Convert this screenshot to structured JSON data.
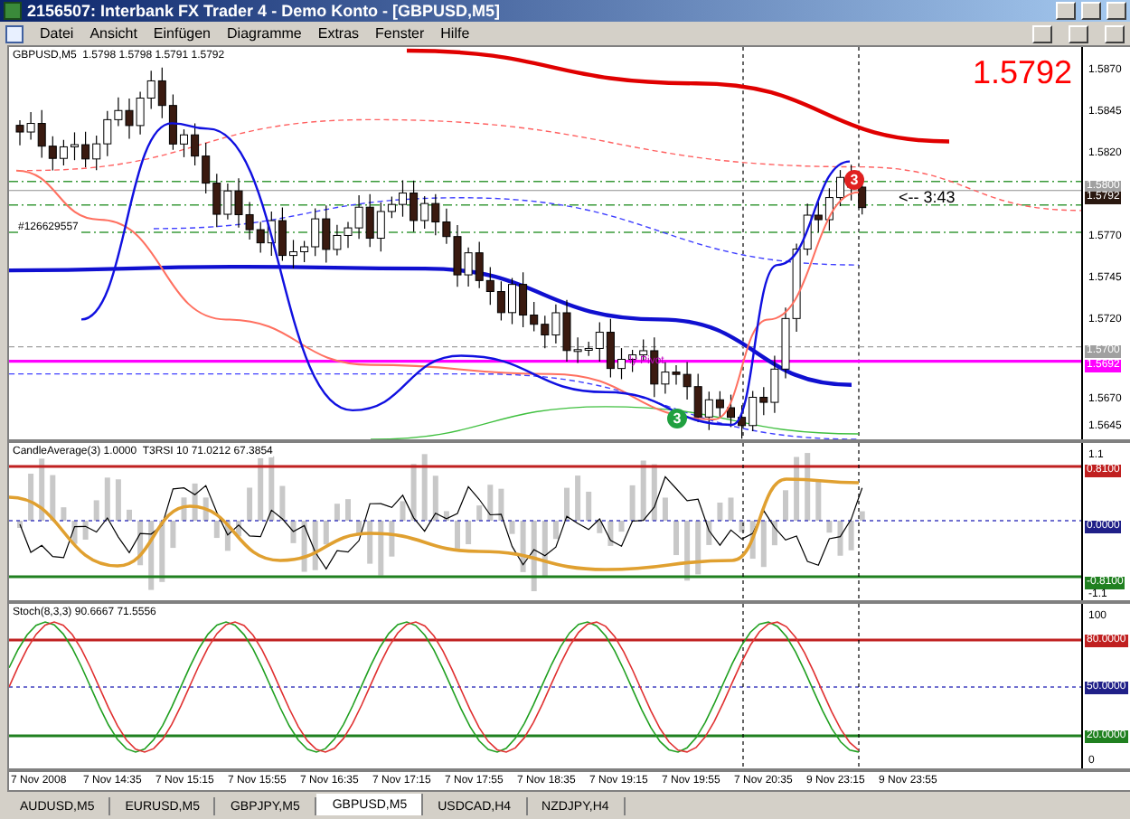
{
  "window": {
    "title": "2156507: Interbank FX Trader 4 - Demo Konto - [GBPUSD,M5]"
  },
  "menu": [
    "Datei",
    "Ansicht",
    "Einfügen",
    "Diagramme",
    "Extras",
    "Fenster",
    "Hilfe"
  ],
  "main_pane": {
    "header": "GBPUSD,M5  1.5798 1.5798 1.5791 1.5792",
    "big_price": "1.5792",
    "countdown": "<-- 3:43",
    "pivot_label": "ly Pivot",
    "order_labels": [
      "#126629557"
    ],
    "markers": [
      {
        "text": "3",
        "color": "#e02020"
      },
      {
        "text": "3",
        "color": "#20a040"
      }
    ],
    "axis": [
      {
        "text": "1.5870",
        "kind": "tick"
      },
      {
        "text": "1.5845",
        "kind": "tick"
      },
      {
        "text": "1.5820",
        "kind": "tick"
      },
      {
        "text": "1.5800",
        "kind": "tag",
        "color": "#a0a0a0"
      },
      {
        "text": "1.5792",
        "kind": "tag",
        "color": "#2a1810"
      },
      {
        "text": "1.5770",
        "kind": "tick"
      },
      {
        "text": "1.5745",
        "kind": "tick"
      },
      {
        "text": "1.5720",
        "kind": "tick"
      },
      {
        "text": "1.5700",
        "kind": "tag",
        "color": "#a0a0a0"
      },
      {
        "text": "1.5692",
        "kind": "tag",
        "color": "#ff00ff"
      },
      {
        "text": "1.5670",
        "kind": "tick"
      },
      {
        "text": "1.5645",
        "kind": "tick"
      }
    ]
  },
  "indicator_panes": [
    {
      "header": "CandleAverage(3) 1.0000  T3RSI 10 71.0212 67.3854",
      "kind": "rsi",
      "axis": [
        {
          "text": "1.1",
          "kind": "tick"
        },
        {
          "text": "0.8100",
          "kind": "tag",
          "color": "#c02020"
        },
        {
          "text": "0.0000",
          "kind": "tag",
          "color": "#202088"
        },
        {
          "text": "-0.8100",
          "kind": "tag",
          "color": "#208020"
        },
        {
          "text": "-1.1",
          "kind": "tick"
        }
      ]
    },
    {
      "header": "Stoch(8,3,3) 90.6667 71.5556",
      "kind": "stoch",
      "axis": [
        {
          "text": "100",
          "kind": "tick"
        },
        {
          "text": "80.0000",
          "kind": "tag",
          "color": "#c02020"
        },
        {
          "text": "50.0000",
          "kind": "tag",
          "color": "#202088"
        },
        {
          "text": "20.0000",
          "kind": "tag",
          "color": "#208020"
        },
        {
          "text": "0",
          "kind": "tick"
        }
      ]
    }
  ],
  "time_axis": [
    "7 Nov 2008",
    "7 Nov 14:35",
    "7 Nov 15:15",
    "7 Nov 15:55",
    "7 Nov 16:35",
    "7 Nov 17:15",
    "7 Nov 17:55",
    "7 Nov 18:35",
    "7 Nov 19:15",
    "7 Nov 19:55",
    "7 Nov 20:35",
    "9 Nov 23:15",
    "9 Nov 23:55"
  ],
  "tabs": [
    {
      "label": "AUDUSD,M5",
      "selected": false
    },
    {
      "label": "EURUSD,M5",
      "selected": false
    },
    {
      "label": "GBPJPY,M5",
      "selected": false
    },
    {
      "label": "GBPUSD,M5",
      "selected": true
    },
    {
      "label": "USDCAD,H4",
      "selected": false
    },
    {
      "label": "NZDJPY,H4",
      "selected": false
    }
  ]
}
